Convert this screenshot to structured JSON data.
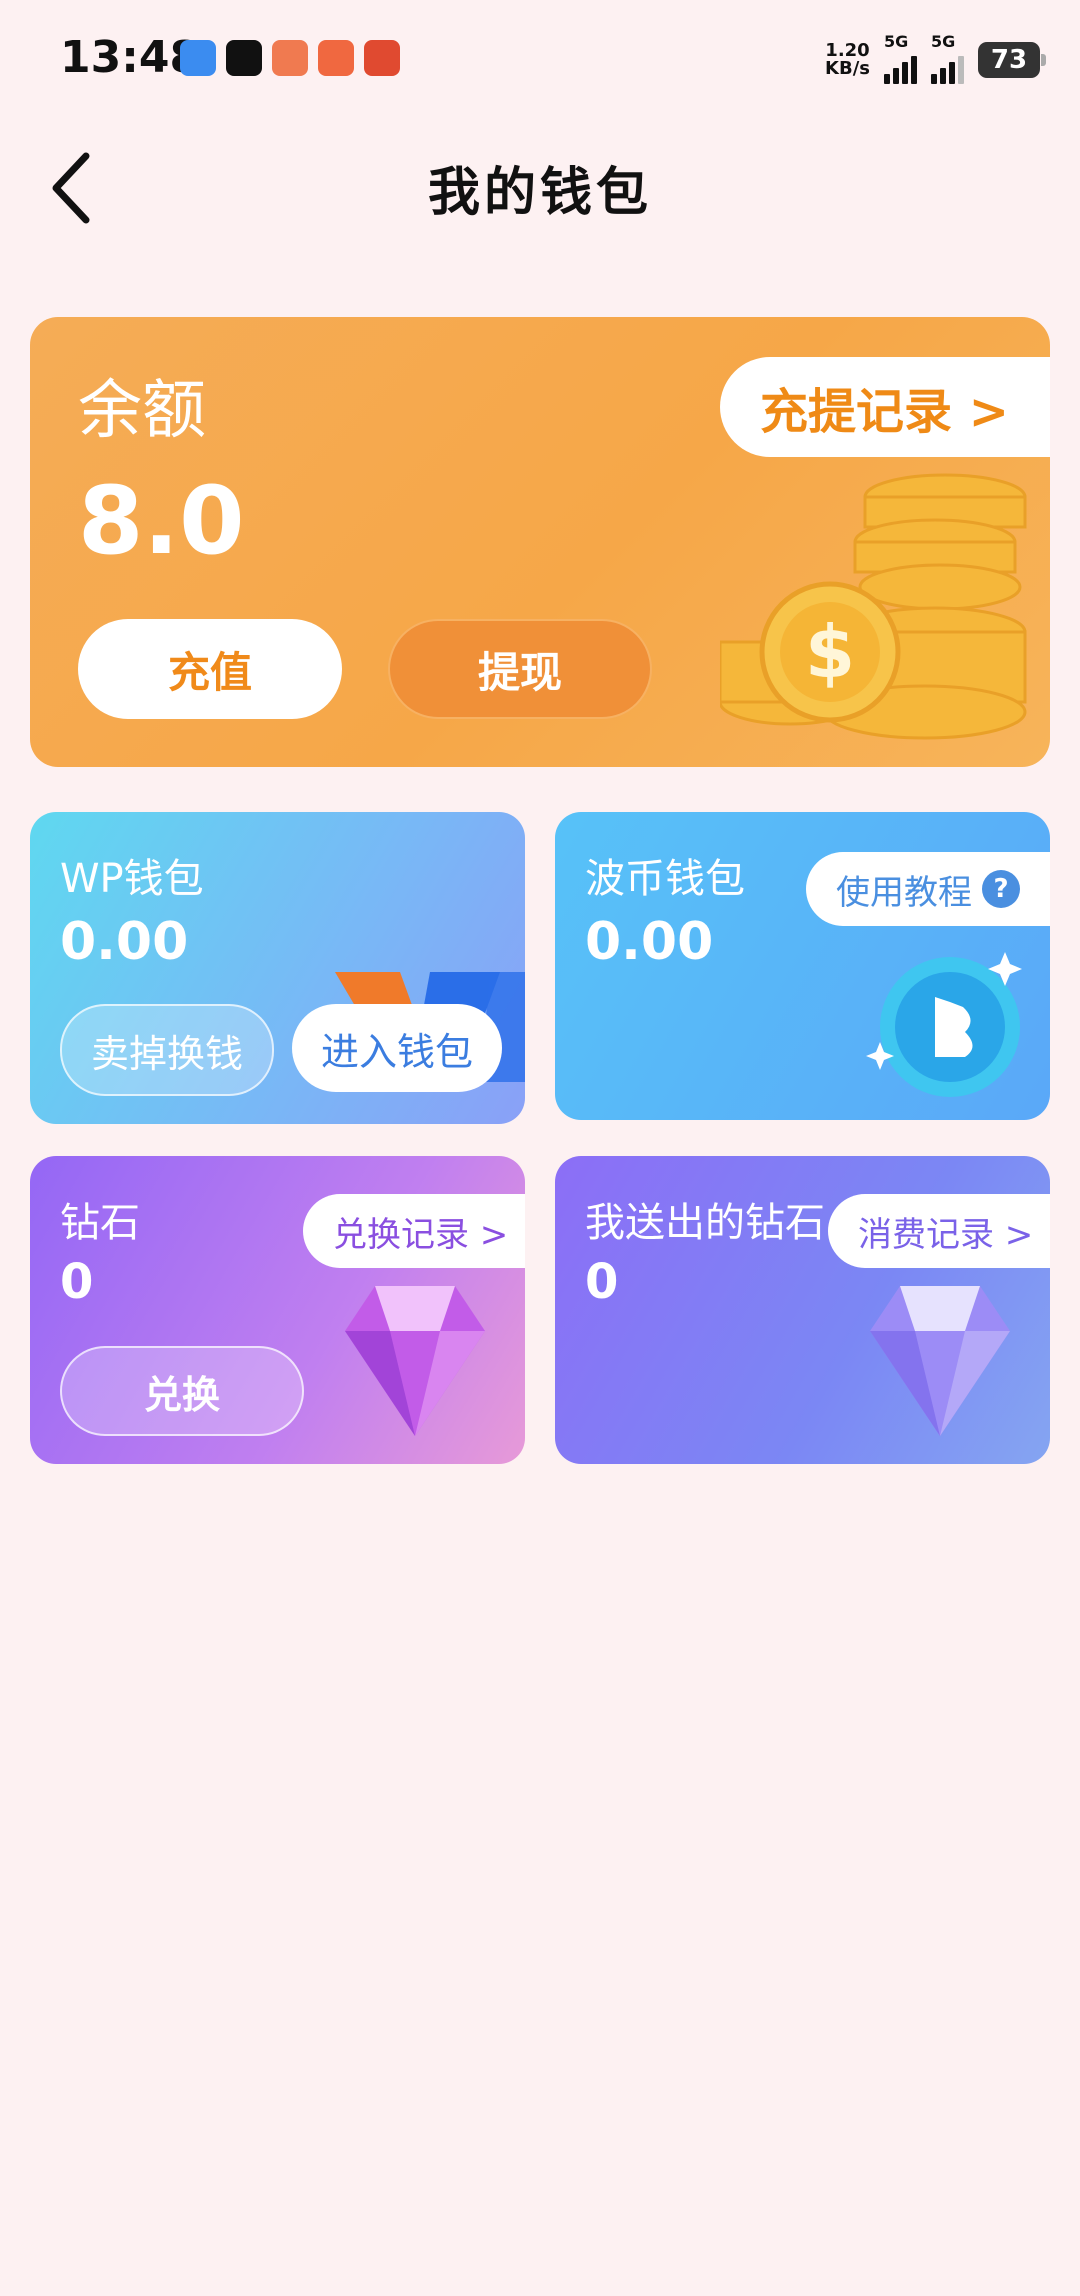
{
  "status_bar": {
    "time": "13:48",
    "net_speed_value": "1.20",
    "net_speed_unit": "KB/s",
    "signal1_label": "5G",
    "signal2_label": "5G",
    "battery": "73",
    "app_icon_colors": [
      "#3b8cf0",
      "#111111",
      "#f07a50",
      "#f06840",
      "#e04a30"
    ]
  },
  "header": {
    "title": "我的钱包"
  },
  "balance_card": {
    "label": "余额",
    "value": "8.0",
    "records_label": "充提记录 >",
    "recharge_label": "充值",
    "withdraw_label": "提现"
  },
  "wp_wallet": {
    "label": "WP钱包",
    "value": "0.00",
    "sell_label": "卖掉换钱",
    "enter_label": "进入钱包"
  },
  "bo_wallet": {
    "label": "波币钱包",
    "value": "0.00",
    "tutorial_label": "使用教程",
    "help_mark": "?"
  },
  "diamond": {
    "label": "钻石",
    "value": "0",
    "records_label": "兑换记录 >",
    "exchange_label": "兑换"
  },
  "sent_diamond": {
    "label": "我送出的钻石",
    "value": "0",
    "records_label": "消费记录 >"
  }
}
